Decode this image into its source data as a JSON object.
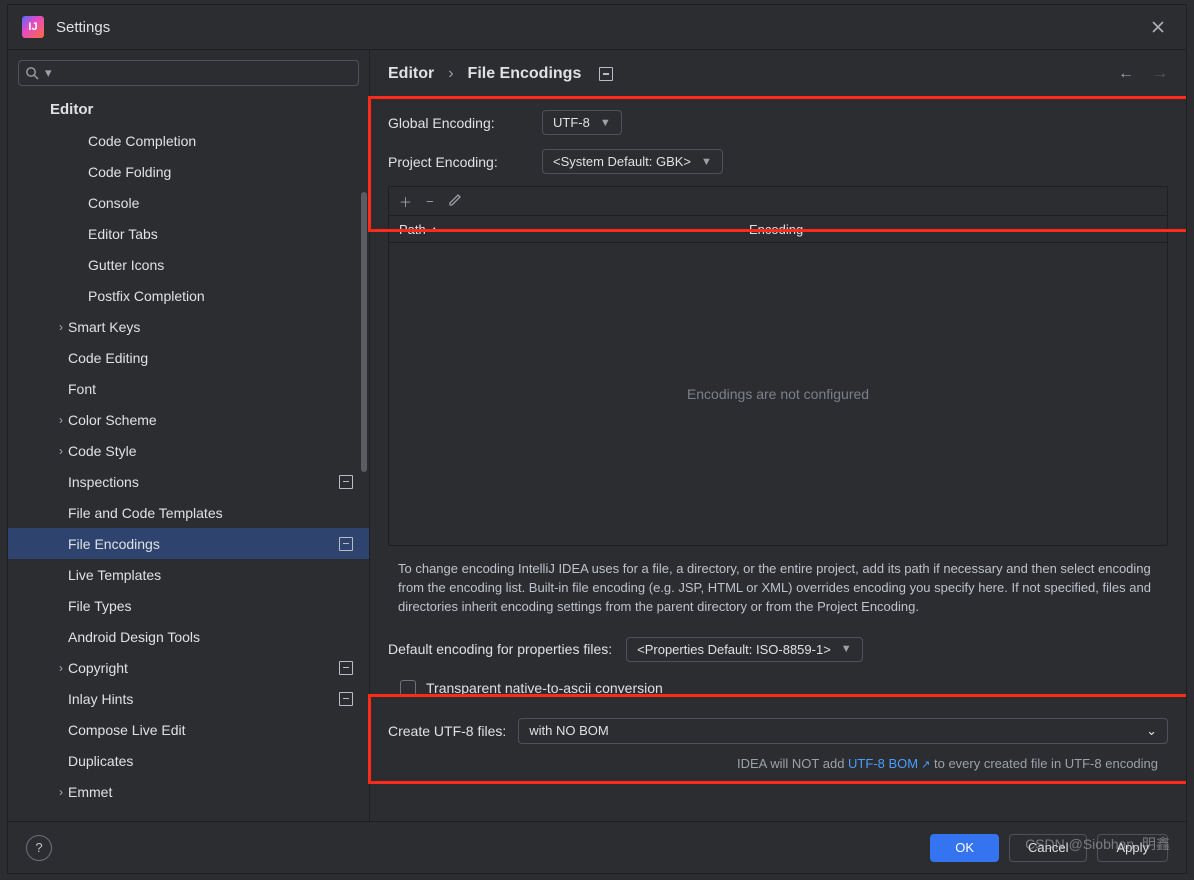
{
  "window": {
    "title": "Settings"
  },
  "search": {
    "placeholder": ""
  },
  "sidebar": {
    "header": "Editor",
    "items": [
      {
        "label": "Code Completion",
        "indent": 84
      },
      {
        "label": "Code Folding",
        "indent": 84
      },
      {
        "label": "Console",
        "indent": 84
      },
      {
        "label": "Editor Tabs",
        "indent": 84
      },
      {
        "label": "Gutter Icons",
        "indent": 84
      },
      {
        "label": "Postfix Completion",
        "indent": 84
      },
      {
        "label": "Smart Keys",
        "indent": 64,
        "expander": "›"
      },
      {
        "label": "Code Editing",
        "indent": 64
      },
      {
        "label": "Font",
        "indent": 64
      },
      {
        "label": "Color Scheme",
        "indent": 64,
        "expander": "›"
      },
      {
        "label": "Code Style",
        "indent": 64,
        "expander": "›"
      },
      {
        "label": "Inspections",
        "indent": 64,
        "project": true
      },
      {
        "label": "File and Code Templates",
        "indent": 64
      },
      {
        "label": "File Encodings",
        "indent": 64,
        "project": true,
        "selected": true
      },
      {
        "label": "Live Templates",
        "indent": 64
      },
      {
        "label": "File Types",
        "indent": 64
      },
      {
        "label": "Android Design Tools",
        "indent": 64
      },
      {
        "label": "Copyright",
        "indent": 64,
        "expander": "›",
        "project": true
      },
      {
        "label": "Inlay Hints",
        "indent": 64,
        "project": true
      },
      {
        "label": "Compose Live Edit",
        "indent": 64
      },
      {
        "label": "Duplicates",
        "indent": 64
      },
      {
        "label": "Emmet",
        "indent": 64,
        "expander": "›"
      }
    ]
  },
  "breadcrumb": {
    "root": "Editor",
    "page": "File Encodings"
  },
  "global": {
    "label": "Global Encoding:",
    "value": "UTF-8"
  },
  "project": {
    "label": "Project Encoding:",
    "value": "<System Default: GBK>"
  },
  "table": {
    "col_path": "Path",
    "col_enc": "Encoding",
    "empty": "Encodings are not configured"
  },
  "explain": "To change encoding IntelliJ IDEA uses for a file, a directory, or the entire project, add its path if necessary and then select encoding from the encoding list. Built-in file encoding (e.g. JSP, HTML or XML) overrides encoding you specify here. If not specified, files and directories inherit encoding settings from the parent directory or from the Project Encoding.",
  "props": {
    "label": "Default encoding for properties files:",
    "value": "<Properties Default: ISO-8859-1>"
  },
  "ascii": {
    "label": "Transparent native-to-ascii conversion"
  },
  "bom": {
    "label": "Create UTF-8 files:",
    "value": "with NO BOM"
  },
  "bom_note": {
    "prefix": "IDEA will NOT add ",
    "link": "UTF-8 BOM",
    "suffix": " to every created file in UTF-8 encoding"
  },
  "buttons": {
    "ok": "OK",
    "cancel": "Cancel",
    "apply": "Apply"
  },
  "watermark": "CSDN @Siobhan. 明鑫"
}
